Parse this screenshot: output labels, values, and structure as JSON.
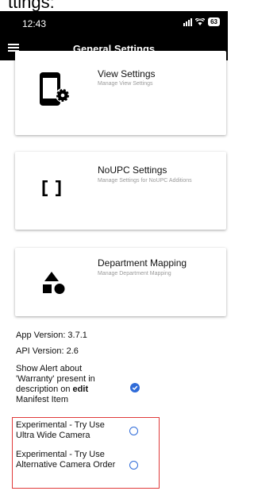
{
  "page_title_fragment": "ttings:",
  "status_bar": {
    "time": "12:43",
    "battery": "63"
  },
  "header": {
    "title": "General Settings"
  },
  "cards": [
    {
      "title": "View Settings",
      "subtitle": "Manage View Settings",
      "icon": "tablet-settings-icon"
    },
    {
      "title": "NoUPC Settings",
      "subtitle": "Manage Settings for NoUPC Additions",
      "icon": "brackets-icon"
    },
    {
      "title": "Department Mapping",
      "subtitle": "Manage Department Mapping",
      "icon": "shapes-icon"
    }
  ],
  "info": {
    "app_version": "App Version: 3.7.1",
    "api_version": "API Version: 2.6"
  },
  "toggles": [
    {
      "label_1": "Show Alert about",
      "label_2": "'Warranty' present in",
      "label_3": "description on ",
      "label_bold": "edit",
      "label_4": "Manifest Item",
      "checked": true
    },
    {
      "label": "Experimental - Try Use Ultra Wide Camera",
      "checked": false
    },
    {
      "label": "Experimental - Try Use Alternative Camera Order",
      "checked": false
    }
  ],
  "colors": {
    "accent": "#2f6bd8",
    "header_bg": "#000000",
    "highlight": "#e03a3a"
  }
}
